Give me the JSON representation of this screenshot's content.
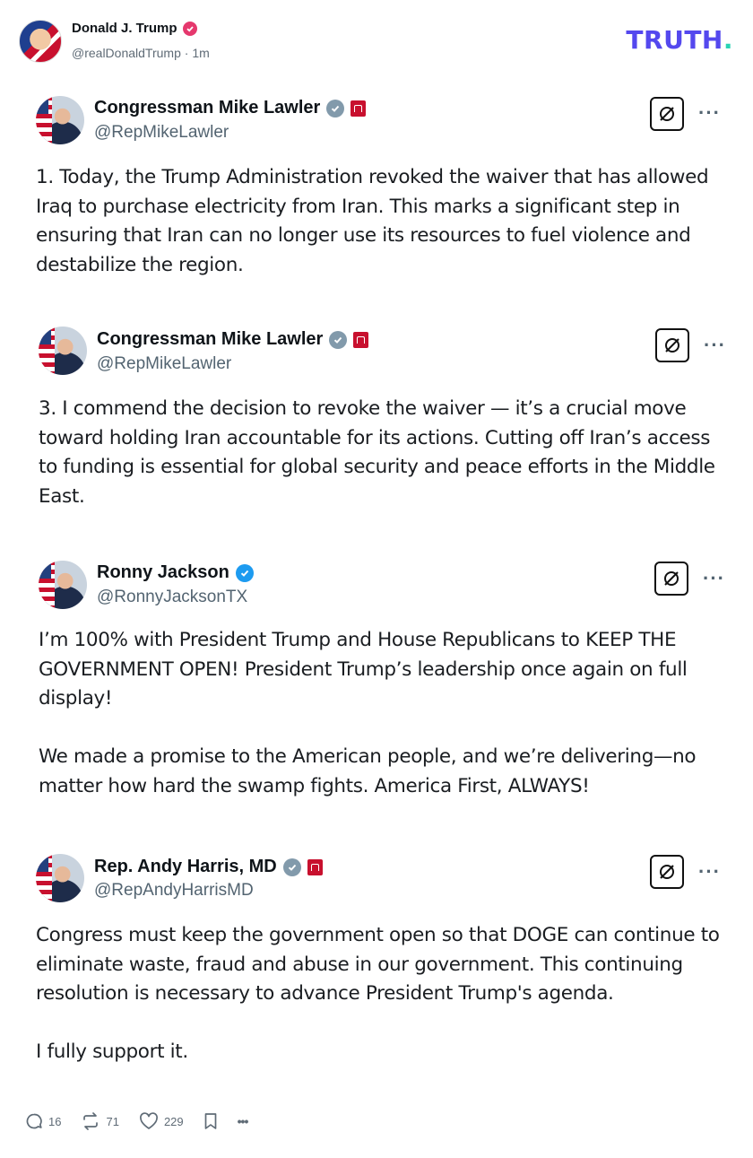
{
  "header": {
    "author_name": "Donald J. Trump",
    "handle": "@realDonaldTrump",
    "time": "1m",
    "logo_text": "TRUTH",
    "logo_dot": "."
  },
  "posts": [
    {
      "name": "Congressman Mike Lawler",
      "handle": "@RepMikeLawler",
      "verified": "gray",
      "flag": true,
      "text": "1. Today, the Trump Administration revoked the waiver that has allowed\nIraq to purchase electricity from Iran. This marks a significant step in\nensuring that Iran can no longer use its resources to fuel violence and\ndestabilize the region."
    },
    {
      "name": "Congressman Mike Lawler",
      "handle": "@RepMikeLawler",
      "verified": "gray",
      "flag": true,
      "text": "3. I commend the decision to revoke the waiver — it’s a crucial move\ntoward holding Iran accountable for its actions. Cutting off Iran’s access\nto funding is essential for global security and peace efforts in the Middle\nEast."
    },
    {
      "name": "Ronny Jackson",
      "handle": "@RonnyJacksonTX",
      "verified": "blue",
      "flag": false,
      "text": "I’m 100% with President Trump and House Republicans to KEEP THE\nGOVERNMENT OPEN! President Trump’s leadership once again on full\ndisplay!\n\nWe made a promise to the American people, and we’re delivering—no\nmatter how hard the swamp fights. America First, ALWAYS!"
    },
    {
      "name": "Rep. Andy Harris, MD",
      "handle": "@RepAndyHarrisMD",
      "verified": "gray",
      "flag": true,
      "text": "Congress must keep the government open so that DOGE can continue to\neliminate waste, fraud and abuse in our government. This continuing\nresolution is necessary to advance President Trump's agenda.\n\nI fully support it."
    }
  ],
  "actions": {
    "replies": "16",
    "retruths": "71",
    "likes": "229",
    "more": "•••"
  },
  "colors": {
    "truth_brand": "#5448ee",
    "truth_dot": "#2ad4b4",
    "verified_pink": "#e5386d",
    "verified_blue": "#1d9bf0",
    "verified_gray": "#829aab"
  }
}
